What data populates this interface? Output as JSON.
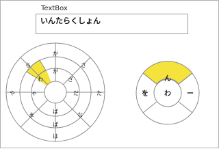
{
  "textbox": {
    "label": "TextBox",
    "value": "いんたらくしょん"
  },
  "colors": {
    "highlight": "#f5e33b",
    "stroke": "#8a8a8a",
    "background": "#ffffff"
  },
  "left_wheel": {
    "outer_ring": [
      "か",
      "さ",
      "た",
      "な",
      "は",
      "ま",
      "や",
      "ら"
    ],
    "inner_ring": [
      "が",
      "ざ",
      "だ",
      "ば",
      "ぱ",
      "ゃ",
      "わ"
    ],
    "highlighted": "わ"
  },
  "right_wheel": {
    "top": "ん",
    "left": "を",
    "center": "わ",
    "right": "ー",
    "highlighted": "ん"
  }
}
